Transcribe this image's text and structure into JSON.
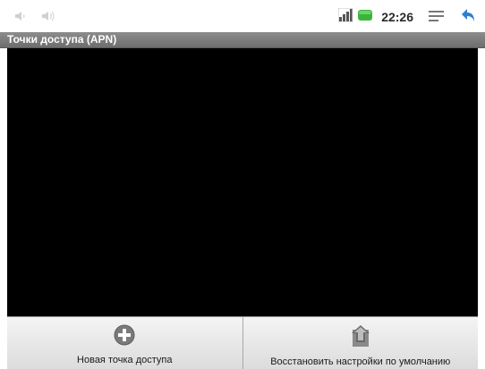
{
  "status_bar": {
    "time": "22:26",
    "icons": [
      "volume-down-icon",
      "volume-up-icon",
      "signal-icon",
      "battery-icon",
      "menu-icon",
      "back-icon"
    ]
  },
  "title_bar": {
    "title": "Точки доступа (APN)"
  },
  "menu": {
    "items": [
      {
        "label": "Новая точка доступа",
        "icon": "add-circle-icon"
      },
      {
        "label": "Восстановить настройки по умолчанию",
        "icon": "restore-icon"
      }
    ]
  },
  "colors": {
    "title_bar": "#7d7d7d",
    "list_bg": "#000000",
    "battery": "#3cb43c",
    "back_arrow": "#2f7fd0"
  }
}
